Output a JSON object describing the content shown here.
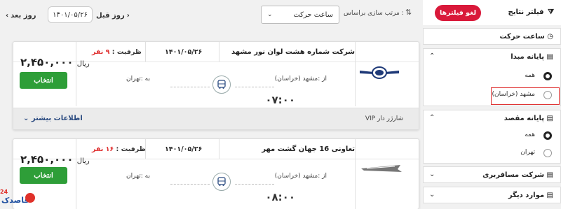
{
  "topbar": {
    "next_day": "روز بعد",
    "prev_day": "روز قبل",
    "date": "۱۴۰۱/۰۵/۲۶",
    "sort_label": "مرتب سازی براساس :",
    "sort_value": "ساعت حرکت"
  },
  "trips": [
    {
      "company": "شرکت شماره هشت لوان نور مشهد",
      "date": "۱۴۰۱/۰۵/۲۶",
      "capacity_label": "ظرفیت :",
      "capacity_value": "۹ نفر",
      "price": "۲,۴۵۰,۰۰۰",
      "currency": "ریال",
      "select": "انتخاب",
      "from": "از :مشهد (خراسان)",
      "to": "به :تهران",
      "time": "۰۷:۰۰",
      "more": "اطلاعات بیشتر",
      "features": "VIP شارژر دار"
    },
    {
      "company": "تعاونی 16 جهان گشت مهر",
      "date": "۱۴۰۱/۰۵/۲۶",
      "capacity_label": "ظرفیت :",
      "capacity_value": "۱۶ نفر",
      "price": "۲,۴۵۰,۰۰۰",
      "currency": "ریال",
      "select": "انتخاب",
      "from": "از :مشهد (خراسان)",
      "to": "به :تهران",
      "time": "۰۸:۰۰"
    }
  ],
  "sidebar": {
    "title": "فیلتر نتایج",
    "clear": "لغو فیلترها",
    "departure_time": "ساعت حرکت",
    "origin_title": "پایانه مبدا",
    "origin_options": [
      "همه",
      "مشهد (خراسان)"
    ],
    "dest_title": "پایانه مقصد",
    "dest_options": [
      "همه",
      "تهران"
    ],
    "company_title": "شرکت مسافربری",
    "other_title": "موارد دیگر"
  },
  "brand": {
    "logo_text": "قاصدک",
    "logo_num": "24"
  },
  "colors": {
    "accent_red": "#d9193a",
    "select_green": "#2e9e38",
    "capacity_red": "#e03232"
  }
}
